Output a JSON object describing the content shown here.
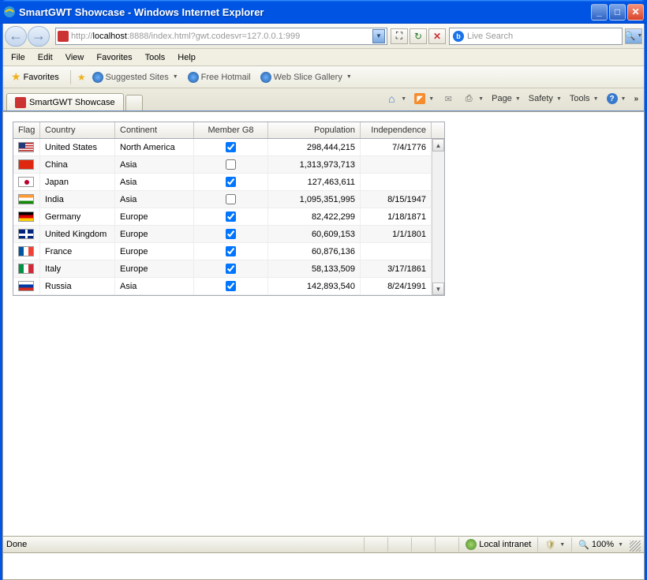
{
  "window": {
    "title": "SmartGWT Showcase - Windows Internet Explorer"
  },
  "address": {
    "prefix": "http://",
    "host": "localhost",
    "rest": ":8888/index.html?gwt.codesvr=127.0.0.1:999"
  },
  "search": {
    "placeholder": "Live Search"
  },
  "menu": {
    "file": "File",
    "edit": "Edit",
    "view": "View",
    "favorites": "Favorites",
    "tools": "Tools",
    "help": "Help"
  },
  "favbar": {
    "favorites": "Favorites",
    "suggested": "Suggested Sites",
    "hotmail": "Free Hotmail",
    "webslice": "Web Slice Gallery"
  },
  "tabs": {
    "tab0": "SmartGWT Showcase",
    "page": "Page",
    "safety": "Safety",
    "tools": "Tools"
  },
  "grid": {
    "headers": {
      "flag": "Flag",
      "country": "Country",
      "continent": "Continent",
      "g8": "Member G8",
      "population": "Population",
      "independence": "Independence"
    },
    "rows": [
      {
        "flagClass": "flag-us",
        "country": "United States",
        "continent": "North America",
        "g8": true,
        "population": "298,444,215",
        "independence": "7/4/1776"
      },
      {
        "flagClass": "flag-cn",
        "country": "China",
        "continent": "Asia",
        "g8": false,
        "population": "1,313,973,713",
        "independence": ""
      },
      {
        "flagClass": "flag-jp",
        "country": "Japan",
        "continent": "Asia",
        "g8": true,
        "population": "127,463,611",
        "independence": ""
      },
      {
        "flagClass": "flag-in",
        "country": "India",
        "continent": "Asia",
        "g8": false,
        "population": "1,095,351,995",
        "independence": "8/15/1947"
      },
      {
        "flagClass": "flag-de",
        "country": "Germany",
        "continent": "Europe",
        "g8": true,
        "population": "82,422,299",
        "independence": "1/18/1871"
      },
      {
        "flagClass": "flag-gb",
        "country": "United Kingdom",
        "continent": "Europe",
        "g8": true,
        "population": "60,609,153",
        "independence": "1/1/1801"
      },
      {
        "flagClass": "flag-fr",
        "country": "France",
        "continent": "Europe",
        "g8": true,
        "population": "60,876,136",
        "independence": ""
      },
      {
        "flagClass": "flag-it",
        "country": "Italy",
        "continent": "Europe",
        "g8": true,
        "population": "58,133,509",
        "independence": "3/17/1861"
      },
      {
        "flagClass": "flag-ru",
        "country": "Russia",
        "continent": "Asia",
        "g8": true,
        "population": "142,893,540",
        "independence": "8/24/1991"
      }
    ]
  },
  "status": {
    "done": "Done",
    "zone": "Local intranet",
    "zoom": "100%"
  }
}
